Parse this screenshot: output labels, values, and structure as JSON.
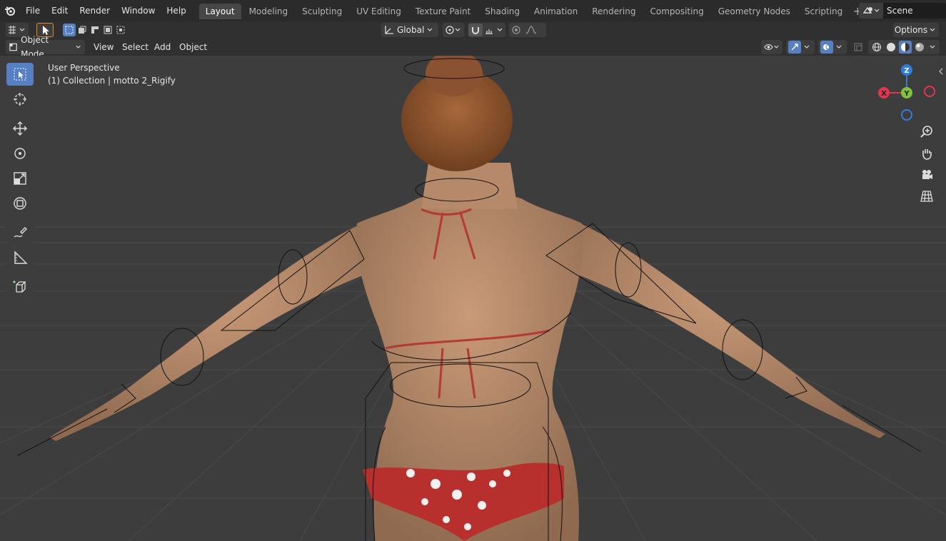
{
  "menu": [
    "File",
    "Edit",
    "Render",
    "Window",
    "Help"
  ],
  "workspaces": [
    "Layout",
    "Modeling",
    "Sculpting",
    "UV Editing",
    "Texture Paint",
    "Shading",
    "Animation",
    "Rendering",
    "Compositing",
    "Geometry Nodes",
    "Scripting"
  ],
  "active_workspace": "Layout",
  "scene": {
    "name": "Scene"
  },
  "toolheader": {
    "orientation": "Global",
    "options_label": "Options"
  },
  "viewport_header": {
    "mode": "Object Mode",
    "menus": [
      "View",
      "Select",
      "Add",
      "Object"
    ]
  },
  "viewport": {
    "perspective_label": "User Perspective",
    "collection_label": "(1) Collection | motto 2_Rigify"
  },
  "gizmo": {
    "z": "Z",
    "y": "Y",
    "x": "X"
  },
  "colors": {
    "accent": "#5680c2",
    "x_axis": "#e0364f",
    "y_axis": "#80c23b",
    "z_axis": "#2f7ed8"
  }
}
